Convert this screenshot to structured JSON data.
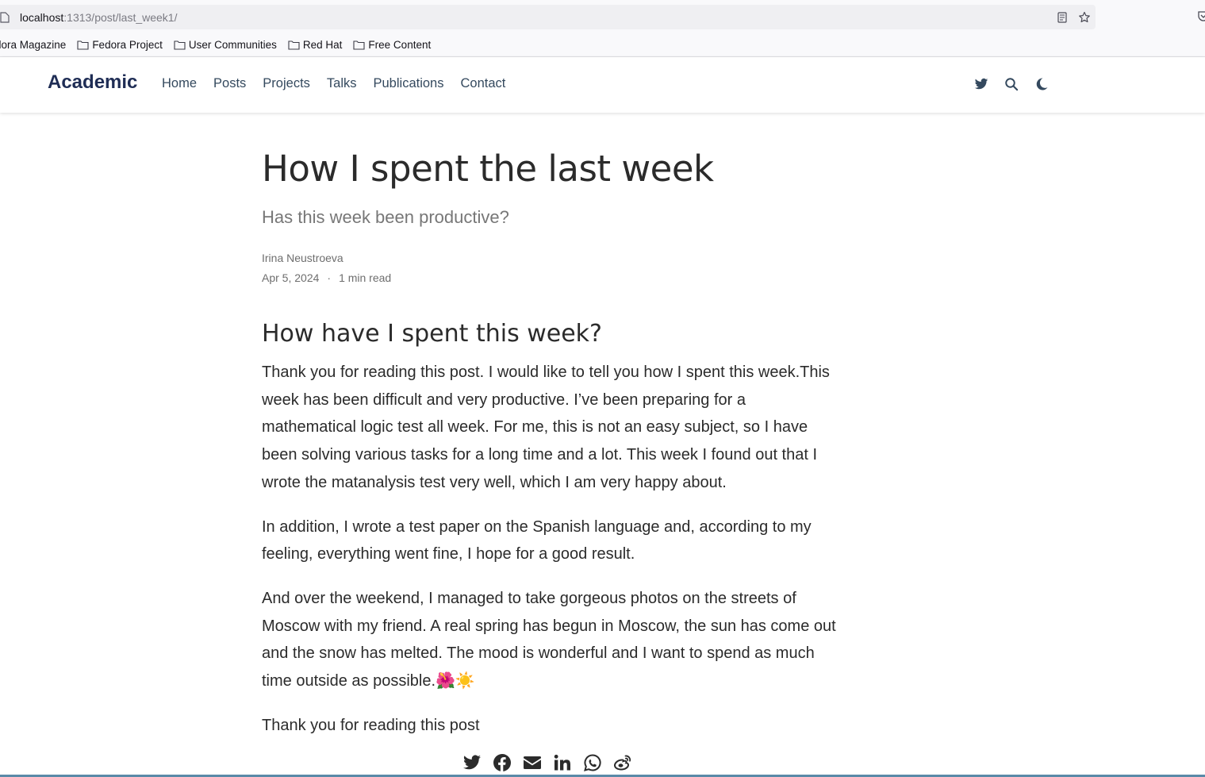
{
  "browser": {
    "url_host": "localhost",
    "url_rest": ":1313/post/last_week1/",
    "bookmarks": [
      "dora Magazine",
      "Fedora Project",
      "User Communities",
      "Red Hat",
      "Free Content"
    ]
  },
  "navbar": {
    "brand": "Academic",
    "links": [
      "Home",
      "Posts",
      "Projects",
      "Talks",
      "Publications",
      "Contact"
    ],
    "icons": [
      "twitter-icon",
      "search-icon",
      "moon-icon"
    ]
  },
  "article": {
    "title": "How I spent the last week",
    "subtitle": "Has this week been productive?",
    "author": "Irina Neustroeva",
    "date": "Apr 5, 2024",
    "separator": "·",
    "reading_time": "1 min read",
    "heading": "How have I spent this week?",
    "paragraphs": [
      "Thank you for reading this post. I would like to tell you how I spent this week.This week has been difficult and very productive. I’ve been preparing for a mathematical logic test all week. For me, this is not an easy subject, so I have been solving various tasks for a long time and a lot. This week I found out that I wrote the matanalysis test very well, which I am very happy about.",
      "In addition, I wrote a test paper on the Spanish language and, according to my feeling, everything went fine, I hope for a good result.",
      "And over the weekend, I managed to take gorgeous photos on the streets of Moscow with my friend. A real spring has begun in Moscow, the sun has come out and the snow has melted. The mood is wonderful and I want to spend as much time outside as possible.🌺☀️",
      "Thank you for reading this post"
    ]
  },
  "share": {
    "icons": [
      "twitter-icon",
      "facebook-icon",
      "email-icon",
      "linkedin-icon",
      "whatsapp-icon",
      "weibo-icon"
    ]
  },
  "colors": {
    "brand": "#1f2d55",
    "nav_text": "#34495e",
    "body_text": "#2b2b2b",
    "muted": "#777777"
  }
}
